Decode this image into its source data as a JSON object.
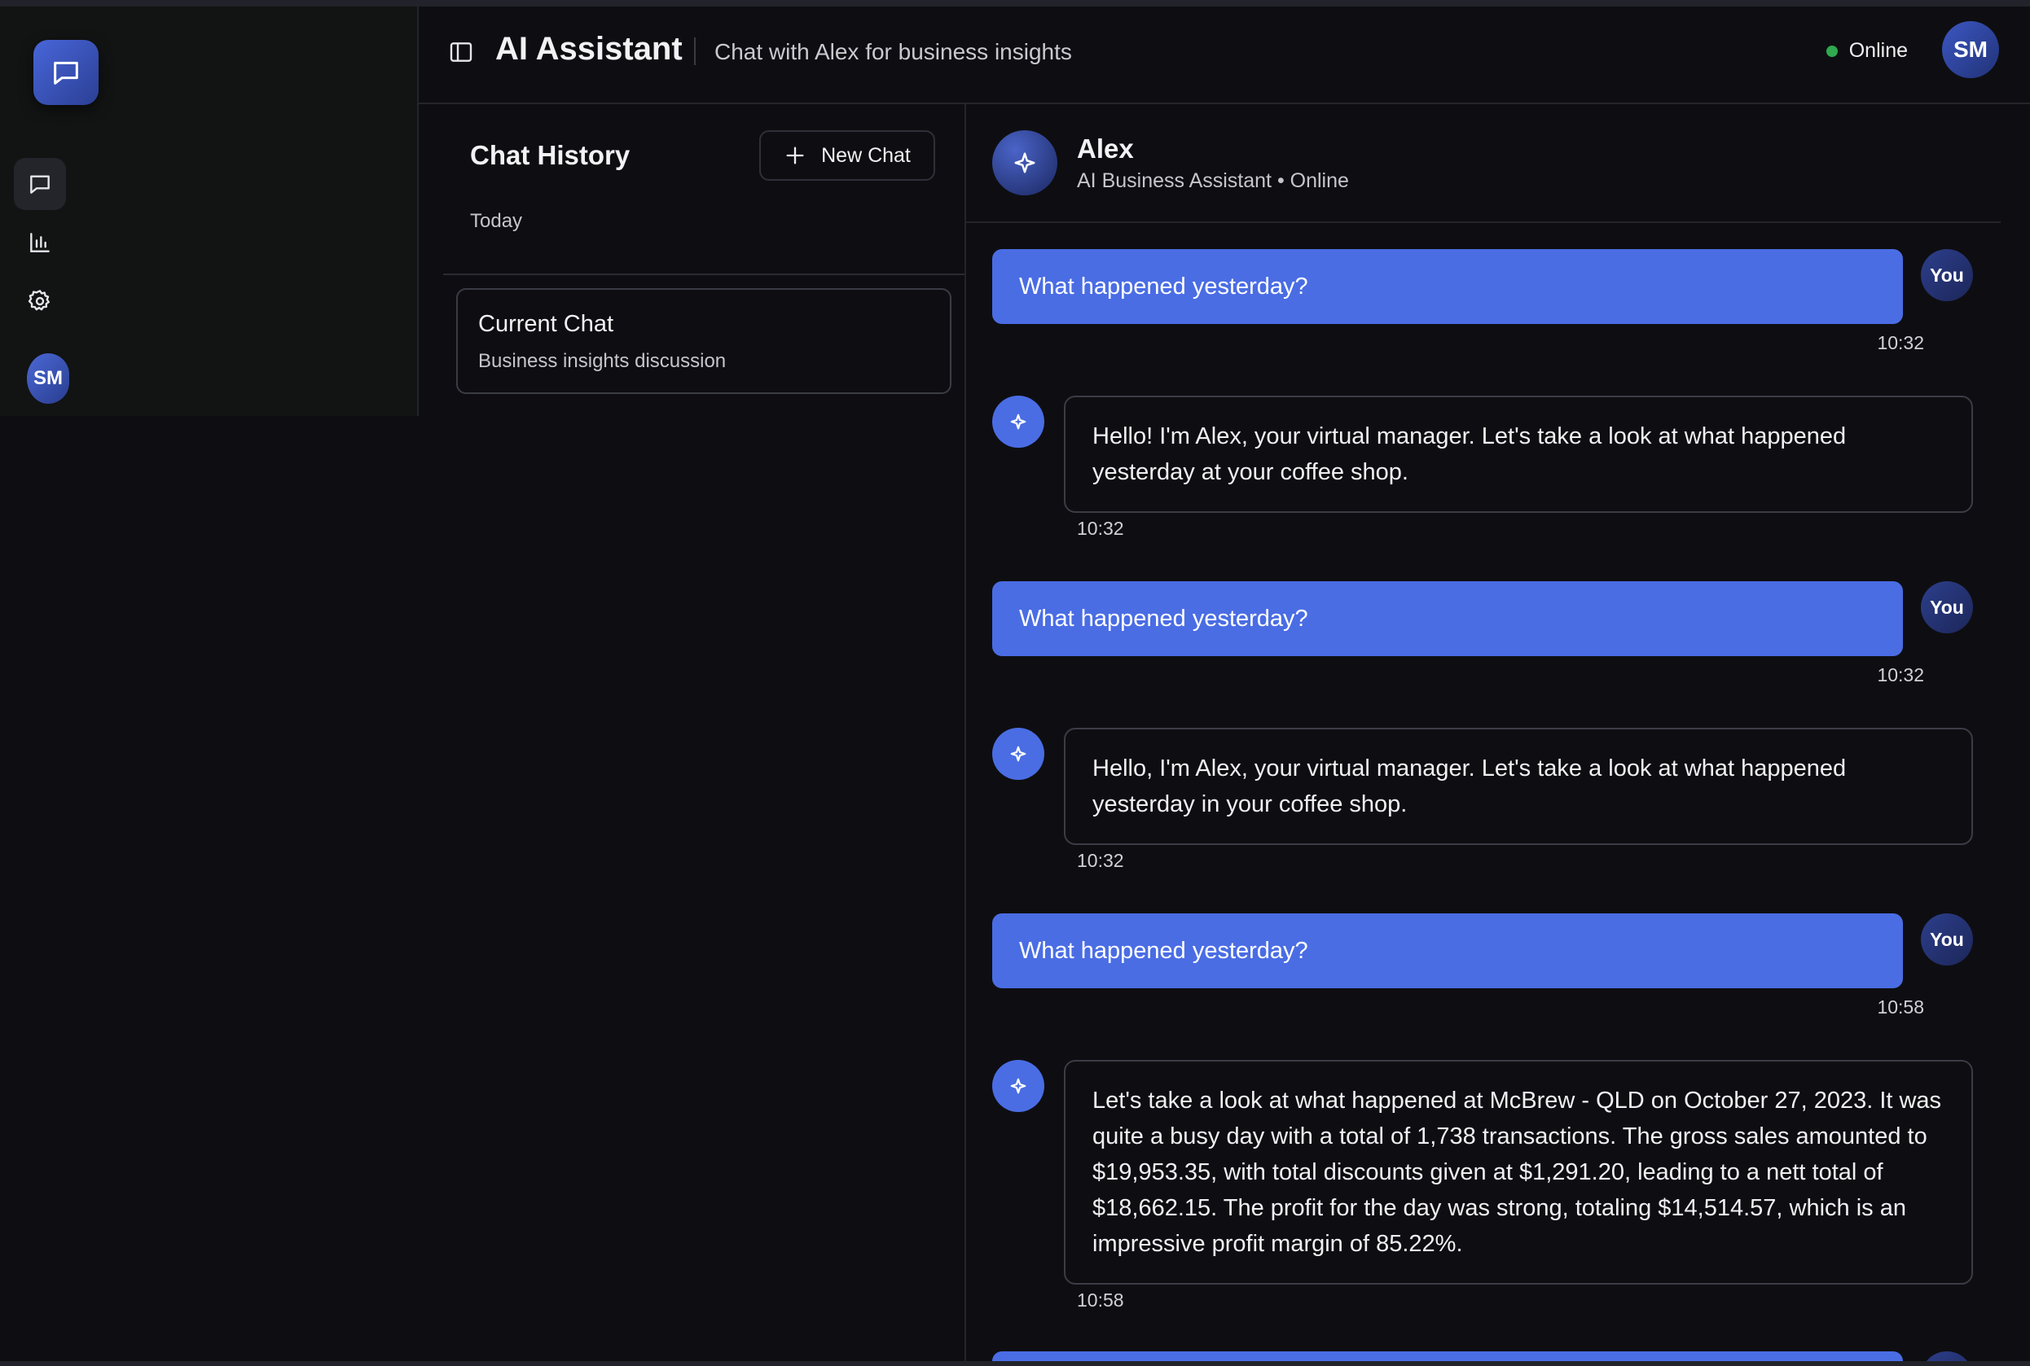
{
  "header": {
    "title": "AI Assistant",
    "subtitle": "Chat with Alex for business insights",
    "status": "Online",
    "user_initials": "SM"
  },
  "rail": {
    "avatar_initials": "SM",
    "icons": [
      "chat-icon",
      "bar-chart-icon",
      "gear-icon"
    ]
  },
  "history": {
    "title": "Chat History",
    "new_chat_label": "New Chat",
    "group_label": "Today",
    "items": [
      {
        "title": "Current Chat",
        "subtitle": "Business insights discussion"
      }
    ]
  },
  "assistant": {
    "name": "Alex",
    "role": "AI Business Assistant • Online"
  },
  "messages": [
    {
      "sender": "user",
      "avatar": "You",
      "text": "What happened yesterday?",
      "time": "10:32"
    },
    {
      "sender": "bot",
      "text": "Hello! I'm Alex, your virtual manager. Let's take a look at what happened yesterday at your coffee shop.",
      "time": "10:32"
    },
    {
      "sender": "user",
      "avatar": "You",
      "text": "What happened yesterday?",
      "time": "10:32"
    },
    {
      "sender": "bot",
      "text": "Hello, I'm Alex, your virtual manager. Let's take a look at what happened yesterday in your coffee shop.",
      "time": "10:32"
    },
    {
      "sender": "user",
      "avatar": "You",
      "text": "What happened yesterday?",
      "time": "10:58"
    },
    {
      "sender": "bot",
      "text": "Let's take a look at what happened at McBrew - QLD on October 27, 2023. It was quite a busy day with a total of 1,738 transactions. The gross sales amounted to $19,953.35, with total discounts given at $1,291.20, leading to a nett total of $18,662.15. The profit for the day was strong, totaling $14,514.57, which is an impressive profit margin of 85.22%.",
      "time": "10:58"
    }
  ],
  "colors": {
    "accent": "#4a6de4",
    "background": "#0e0e12",
    "online": "#2fa84f"
  }
}
